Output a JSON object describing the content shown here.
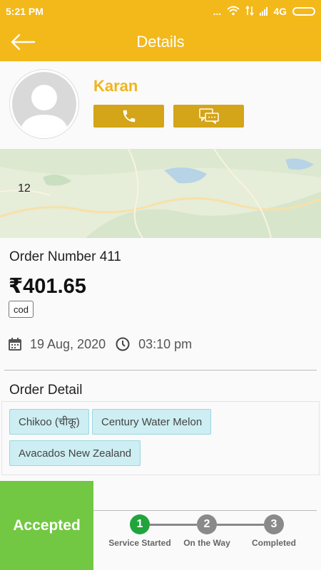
{
  "status_bar": {
    "time": "5:21 PM",
    "dots": "...",
    "network": "4G"
  },
  "app_bar": {
    "title": "Details"
  },
  "profile": {
    "name": "Karan"
  },
  "map": {
    "label": "12"
  },
  "order": {
    "number_text": "Order Number 411",
    "amount": "₹401.65",
    "payment_method": "cod",
    "date": "19 Aug, 2020",
    "time": "03:10 pm"
  },
  "order_detail": {
    "title": "Order Detail",
    "items": [
      "Chikoo (चीकू)",
      "Century Water Melon",
      "Avacados New Zealand"
    ]
  },
  "status_button": {
    "label": "Accepted",
    "color": "#72c842"
  },
  "steps": [
    {
      "number": "1",
      "label": "Service Started",
      "state": "done"
    },
    {
      "number": "2",
      "label": "On the Way",
      "state": "pending"
    },
    {
      "number": "3",
      "label": "Completed",
      "state": "pending"
    }
  ],
  "colors": {
    "accent": "#f3b81a",
    "button": "#d4a419",
    "chip": "#cdeef2",
    "step_done": "#22a43c",
    "step_pending": "#8a8a8a"
  }
}
